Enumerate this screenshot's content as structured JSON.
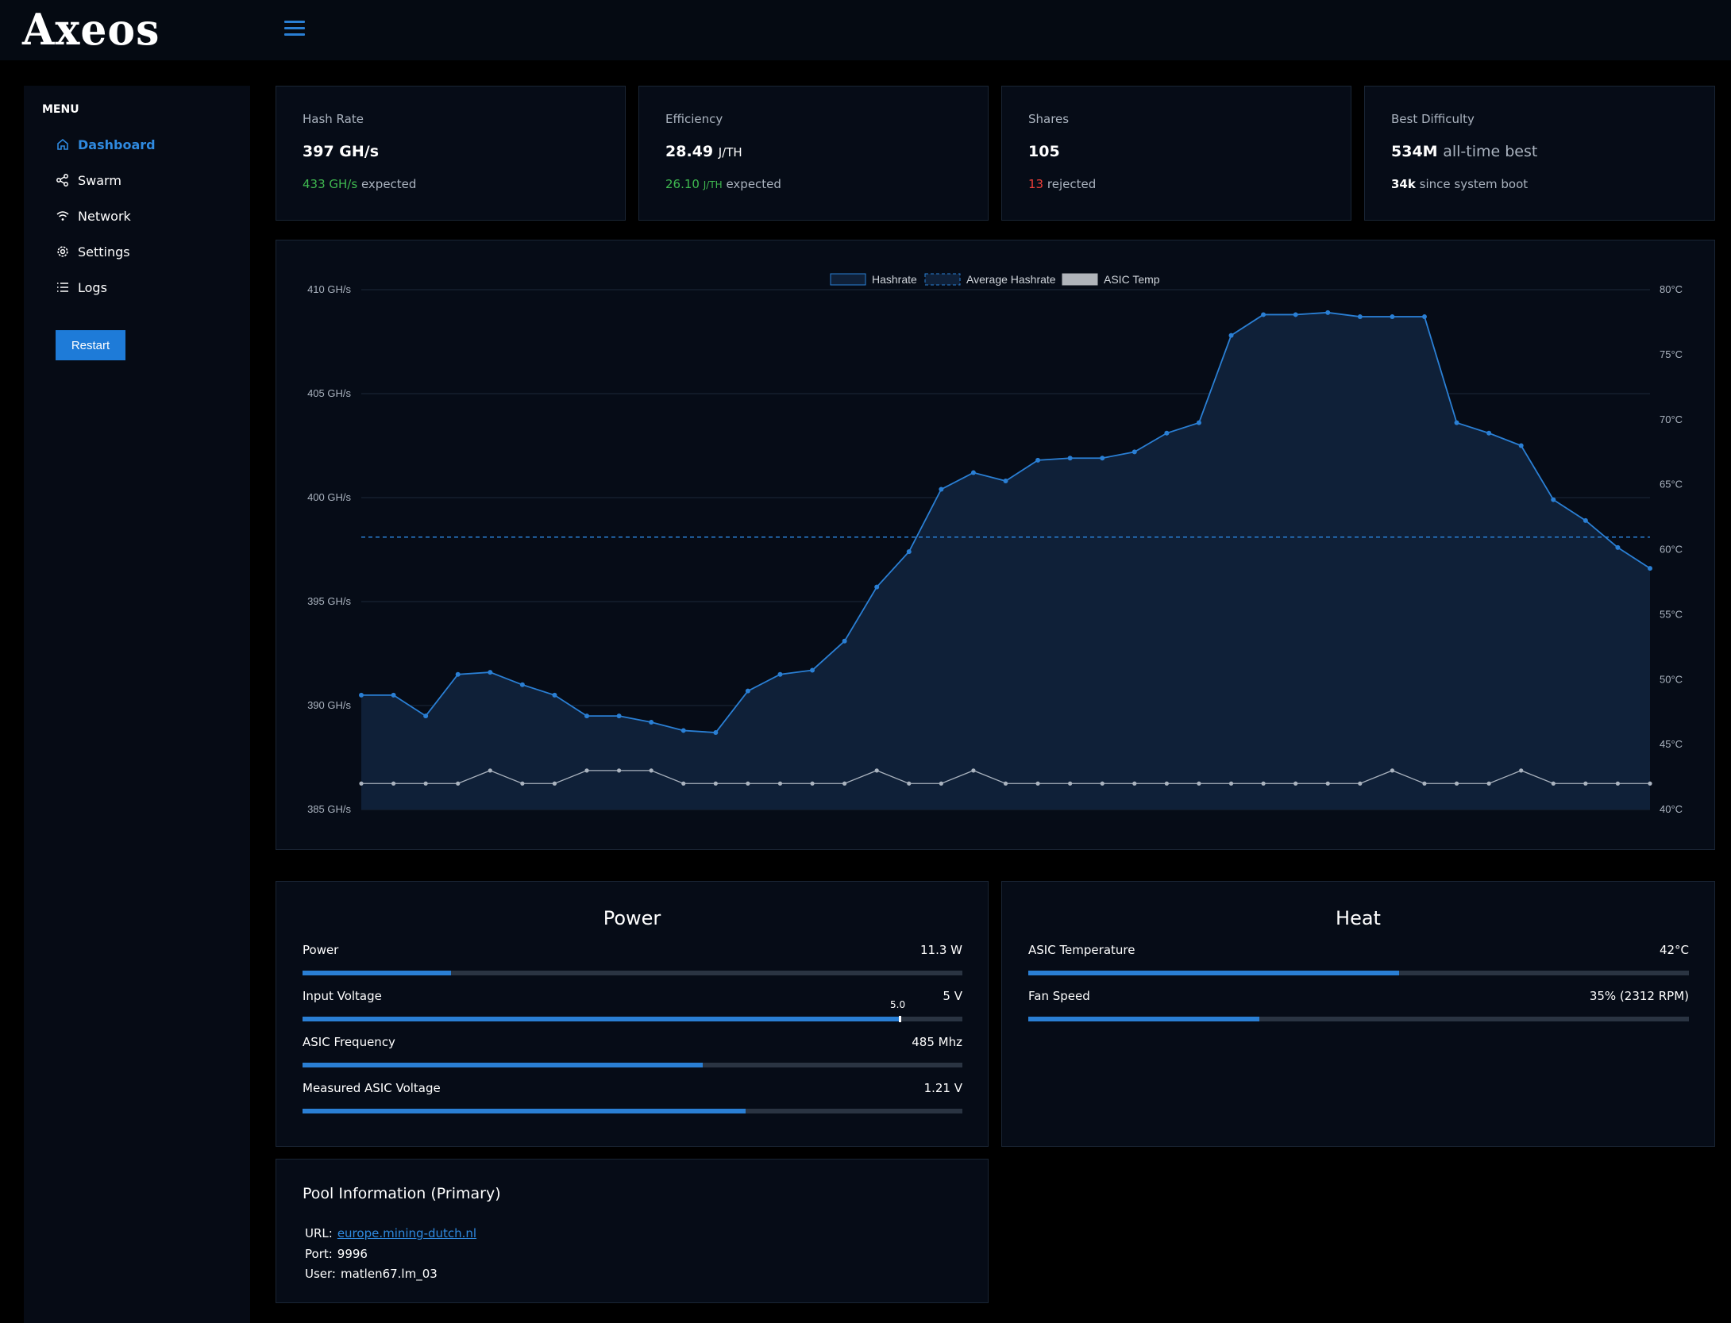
{
  "app": {
    "logo": "Axeos"
  },
  "sidebar": {
    "menu_title": "MENU",
    "items": [
      {
        "label": "Dashboard",
        "icon": "home-icon",
        "active": true
      },
      {
        "label": "Swarm",
        "icon": "share-icon",
        "active": false
      },
      {
        "label": "Network",
        "icon": "wifi-icon",
        "active": false
      },
      {
        "label": "Settings",
        "icon": "gear-icon",
        "active": false
      },
      {
        "label": "Logs",
        "icon": "list-icon",
        "active": false
      }
    ],
    "restart_label": "Restart"
  },
  "stats": {
    "hashrate": {
      "label": "Hash Rate",
      "value": "397 GH/s",
      "expected_value": "433 GH/s",
      "expected_text": "expected"
    },
    "efficiency": {
      "label": "Efficiency",
      "value": "28.49",
      "unit": "J/TH",
      "expected_value": "26.10",
      "expected_unit": "J/TH",
      "expected_text": "expected"
    },
    "shares": {
      "label": "Shares",
      "value": "105",
      "rejected_value": "13",
      "rejected_text": "rejected"
    },
    "best_difficulty": {
      "label": "Best Difficulty",
      "value": "534M",
      "value_suffix": "all-time best",
      "since_value": "34k",
      "since_text": "since system boot"
    }
  },
  "chart_data": {
    "type": "line",
    "legend": [
      "Hashrate",
      "Average Hashrate",
      "ASIC Temp"
    ],
    "left_axis": {
      "ticks": [
        "410 GH/s",
        "405 GH/s",
        "400 GH/s",
        "395 GH/s",
        "390 GH/s",
        "385 GH/s"
      ],
      "ylim": [
        385,
        410
      ]
    },
    "right_axis": {
      "ticks": [
        "80°C",
        "75°C",
        "70°C",
        "65°C",
        "60°C",
        "55°C",
        "50°C",
        "45°C",
        "40°C"
      ],
      "ylim": [
        40,
        80
      ]
    },
    "series": [
      {
        "name": "Hashrate",
        "values": [
          390.5,
          390.5,
          389.5,
          391.5,
          391.6,
          391.0,
          390.5,
          389.5,
          389.5,
          389.2,
          388.8,
          388.7,
          390.7,
          391.5,
          391.7,
          393.1,
          395.7,
          397.4,
          400.4,
          401.2,
          400.8,
          401.8,
          401.9,
          401.9,
          402.2,
          403.1,
          403.6,
          407.8,
          408.8,
          408.8,
          408.9,
          408.7,
          408.7,
          408.7,
          403.6,
          403.1,
          402.5,
          399.9,
          398.9,
          397.6,
          396.6
        ]
      },
      {
        "name": "Average Hashrate",
        "value": 398.1
      },
      {
        "name": "ASIC Temp",
        "values": [
          42,
          42,
          42,
          42,
          43,
          42,
          42,
          43,
          43,
          43,
          42,
          42,
          42,
          42,
          42,
          42,
          43,
          42,
          42,
          43,
          42,
          42,
          42,
          42,
          42,
          42,
          42,
          42,
          42,
          42,
          42,
          42,
          43,
          42,
          42,
          42,
          43,
          42,
          42,
          42,
          42
        ]
      }
    ],
    "colors": {
      "hashrate": "#2a7fd4",
      "average": "#2a7fd4",
      "temp": "#aab3bf"
    }
  },
  "power": {
    "title": "Power",
    "metrics": [
      {
        "label": "Power",
        "value": "11.3 W",
        "fill": 0.225
      },
      {
        "label": "Input Voltage",
        "value": "5 V",
        "fill": 0.905,
        "marker_label": "5.0"
      },
      {
        "label": "ASIC Frequency",
        "value": "485 Mhz",
        "fill": 0.607
      },
      {
        "label": "Measured ASIC Voltage",
        "value": "1.21 V",
        "fill": 0.672
      }
    ]
  },
  "heat": {
    "title": "Heat",
    "metrics": [
      {
        "label": "ASIC Temperature",
        "value": "42°C",
        "fill": 0.561
      },
      {
        "label": "Fan Speed",
        "value": "35% (2312 RPM)",
        "fill": 0.35
      }
    ]
  },
  "pool": {
    "title": "Pool Information (Primary)",
    "url_label": "URL:",
    "url": "europe.mining-dutch.nl",
    "port_label": "Port:",
    "port": "9996",
    "user_label": "User:",
    "user": "matlen67.lm_03"
  }
}
